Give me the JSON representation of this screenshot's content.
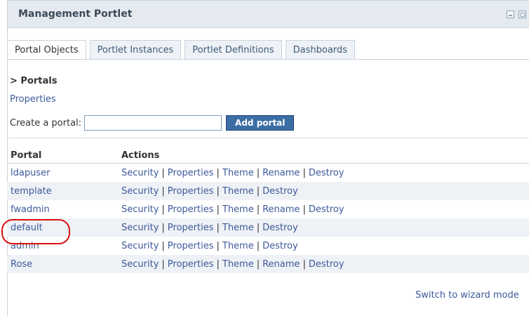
{
  "portlet": {
    "title": "Management Portlet"
  },
  "title_icons": [
    "minimize-icon",
    "maximize-icon"
  ],
  "tabs": [
    {
      "label": "Portal Objects",
      "active": true
    },
    {
      "label": "Portlet Instances",
      "active": false
    },
    {
      "label": "Portlet Definitions",
      "active": false
    },
    {
      "label": "Dashboards",
      "active": false
    }
  ],
  "breadcrumb": "> Portals",
  "properties_link": "Properties",
  "create": {
    "label": "Create a portal:",
    "value": "",
    "button": "Add portal"
  },
  "table": {
    "headers": [
      "Portal",
      "Actions"
    ],
    "rows": [
      {
        "name": "ldapuser",
        "actions": [
          "Security",
          "Properties",
          "Theme",
          "Rename",
          "Destroy"
        ]
      },
      {
        "name": "template",
        "actions": [
          "Security",
          "Properties",
          "Theme",
          "Destroy"
        ]
      },
      {
        "name": "fwadmin",
        "actions": [
          "Security",
          "Properties",
          "Theme",
          "Rename",
          "Destroy"
        ]
      },
      {
        "name": "default",
        "actions": [
          "Security",
          "Properties",
          "Theme",
          "Destroy"
        ]
      },
      {
        "name": "admin",
        "actions": [
          "Security",
          "Properties",
          "Theme",
          "Destroy"
        ]
      },
      {
        "name": "Rose",
        "actions": [
          "Security",
          "Properties",
          "Theme",
          "Rename",
          "Destroy"
        ]
      }
    ]
  },
  "switch_link": "Switch to wizard mode",
  "colors": {
    "link": "#3d5a9a",
    "button": "#3b6ea5",
    "titlebar": "#e4eaf0",
    "highlight": "#dd1111",
    "alt_row": "#eef1f5"
  }
}
